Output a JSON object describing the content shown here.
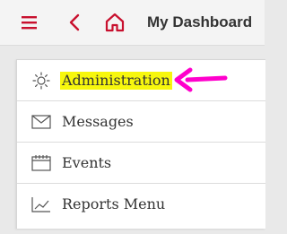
{
  "header": {
    "title": "My Dashboard",
    "icons": [
      "hamburger-menu-icon",
      "chevron-left-icon",
      "home-icon"
    ],
    "accent_color": "#c8102e"
  },
  "menu": {
    "items": [
      {
        "label": "Administration",
        "icon": "gear-icon",
        "highlighted": true
      },
      {
        "label": "Messages",
        "icon": "envelope-icon"
      },
      {
        "label": "Events",
        "icon": "calendar-icon"
      },
      {
        "label": "Reports Menu",
        "icon": "chart-icon"
      }
    ],
    "highlight_color": "#f7f70d"
  },
  "annotation": {
    "icon": "arrow-left-icon",
    "color": "#ff00cc"
  }
}
